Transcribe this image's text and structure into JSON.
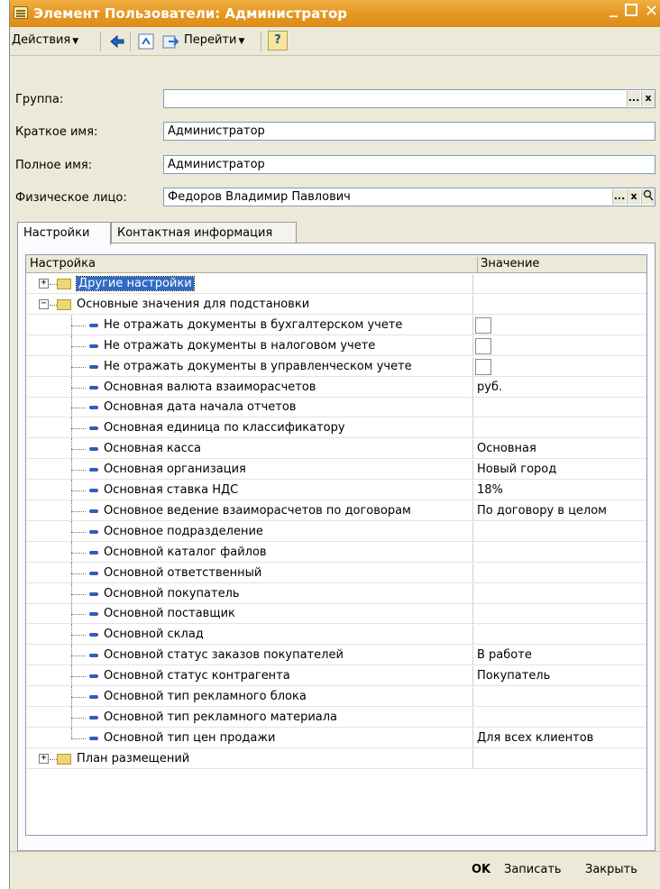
{
  "window": {
    "title": "Элемент Пользователи: Администратор",
    "controls": {
      "minimize": "_",
      "close": "✕"
    }
  },
  "toolbar": {
    "actions_label": "Действия",
    "goto_label": "Перейти",
    "help_label": "?"
  },
  "form": {
    "group": {
      "label": "Группа:",
      "value": "",
      "btn_select": "...",
      "btn_clear": "x"
    },
    "short_name": {
      "label": "Краткое имя:",
      "value": "Администратор"
    },
    "full_name": {
      "label": "Полное имя:",
      "value": "Администратор"
    },
    "person": {
      "label": "Физическое лицо:",
      "value": "Федоров Владимир Павлович",
      "btn_select": "...",
      "btn_clear": "x"
    }
  },
  "tabs": [
    {
      "label": "Настройки",
      "active": true
    },
    {
      "label": "Контактная информация",
      "active": false
    }
  ],
  "grid": {
    "columns": [
      "Настройка",
      "Значение"
    ],
    "rows": [
      {
        "label": "Другие настройки",
        "level": 0,
        "kind": "folder",
        "expander": "+",
        "value": ""
      },
      {
        "label": "Основные значения для подстановки",
        "level": 0,
        "kind": "folder",
        "expander": "−",
        "value": ""
      },
      {
        "label": "Не отражать документы в бухгалтерском учете",
        "level": 1,
        "kind": "item",
        "value": "",
        "checkbox": true
      },
      {
        "label": "Не отражать документы в налоговом учете",
        "level": 1,
        "kind": "item",
        "value": "",
        "checkbox": true
      },
      {
        "label": "Не отражать документы в управленческом учете",
        "level": 1,
        "kind": "item",
        "value": "",
        "checkbox": true
      },
      {
        "label": "Основная валюта взаиморасчетов",
        "level": 1,
        "kind": "item",
        "value": "руб."
      },
      {
        "label": "Основная дата начала отчетов",
        "level": 1,
        "kind": "item",
        "value": ""
      },
      {
        "label": "Основная единица по классификатору",
        "level": 1,
        "kind": "item",
        "value": ""
      },
      {
        "label": "Основная касса",
        "level": 1,
        "kind": "item",
        "value": "Основная"
      },
      {
        "label": "Основная организация",
        "level": 1,
        "kind": "item",
        "value": "Новый город"
      },
      {
        "label": "Основная ставка НДС",
        "level": 1,
        "kind": "item",
        "value": "18%"
      },
      {
        "label": "Основное ведение взаиморасчетов по договорам",
        "level": 1,
        "kind": "item",
        "value": "По договору в целом"
      },
      {
        "label": "Основное подразделение",
        "level": 1,
        "kind": "item",
        "value": ""
      },
      {
        "label": "Основной каталог файлов",
        "level": 1,
        "kind": "item",
        "value": ""
      },
      {
        "label": "Основной ответственный",
        "level": 1,
        "kind": "item",
        "value": ""
      },
      {
        "label": "Основной покупатель",
        "level": 1,
        "kind": "item",
        "value": ""
      },
      {
        "label": "Основной поставщик",
        "level": 1,
        "kind": "item",
        "value": ""
      },
      {
        "label": "Основной склад",
        "level": 1,
        "kind": "item",
        "value": ""
      },
      {
        "label": "Основной статус заказов покупателей",
        "level": 1,
        "kind": "item",
        "value": "В работе"
      },
      {
        "label": "Основной статус контрагента",
        "level": 1,
        "kind": "item",
        "value": "Покупатель"
      },
      {
        "label": "Основной тип рекламного блока",
        "level": 1,
        "kind": "item",
        "value": ""
      },
      {
        "label": "Основной тип рекламного материала",
        "level": 1,
        "kind": "item",
        "value": ""
      },
      {
        "label": "Основной тип цен продажи",
        "level": 1,
        "kind": "item",
        "value": "Для всех клиентов"
      },
      {
        "label": "План размещений",
        "level": 0,
        "kind": "folder",
        "expander": "+",
        "value": ""
      }
    ]
  },
  "footer": {
    "ok_label": "OK",
    "save_label": "Записать",
    "close_label": "Закрыть"
  }
}
